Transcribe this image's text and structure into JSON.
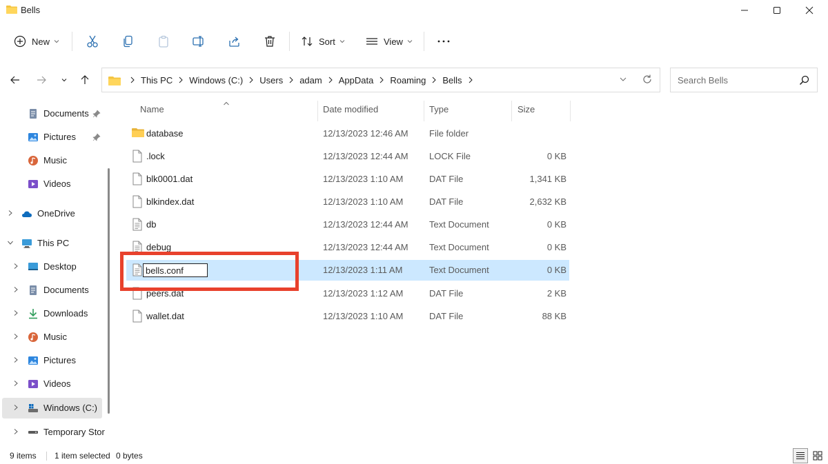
{
  "window": {
    "title": "Bells",
    "accent_folder_color": "#f4c542"
  },
  "toolbar": {
    "new_label": "New",
    "sort_label": "Sort",
    "view_label": "View",
    "more_label": "···"
  },
  "address": {
    "breadcrumbs": [
      "This PC",
      "Windows (C:)",
      "Users",
      "adam",
      "AppData",
      "Roaming",
      "Bells"
    ],
    "search_placeholder": "Search Bells"
  },
  "sidebar": {
    "items": [
      {
        "label": "Documents",
        "icon": "documents-icon",
        "pinned": true
      },
      {
        "label": "Pictures",
        "icon": "pictures-icon",
        "pinned": true
      },
      {
        "label": "Music",
        "icon": "music-icon",
        "pinned": false
      },
      {
        "label": "Videos",
        "icon": "videos-icon",
        "pinned": false
      },
      {
        "label": "OneDrive",
        "icon": "onedrive-icon",
        "pinned": false
      },
      {
        "label": "This PC",
        "icon": "this-pc-icon",
        "pinned": false
      },
      {
        "label": "Desktop",
        "icon": "desktop-icon",
        "pinned": false
      },
      {
        "label": "Documents",
        "icon": "documents-icon",
        "pinned": false
      },
      {
        "label": "Downloads",
        "icon": "downloads-icon",
        "pinned": false
      },
      {
        "label": "Music",
        "icon": "music-icon",
        "pinned": false
      },
      {
        "label": "Pictures",
        "icon": "pictures-icon",
        "pinned": false
      },
      {
        "label": "Videos",
        "icon": "videos-icon",
        "pinned": false
      },
      {
        "label": "Windows (C:)",
        "icon": "drive-icon",
        "pinned": false,
        "selected": true
      },
      {
        "label": "Temporary Stor",
        "icon": "removable-drive-icon",
        "pinned": false
      }
    ]
  },
  "filelist": {
    "columns": {
      "name": "Name",
      "date": "Date modified",
      "type": "Type",
      "size": "Size"
    },
    "rows": [
      {
        "name": "database",
        "date": "12/13/2023 12:46 AM",
        "type": "File folder",
        "size": "",
        "icon": "folder-icon"
      },
      {
        "name": ".lock",
        "date": "12/13/2023 12:44 AM",
        "type": "LOCK File",
        "size": "0 KB",
        "icon": "file-icon"
      },
      {
        "name": "blk0001.dat",
        "date": "12/13/2023 1:10 AM",
        "type": "DAT File",
        "size": "1,341 KB",
        "icon": "file-icon"
      },
      {
        "name": "blkindex.dat",
        "date": "12/13/2023 1:10 AM",
        "type": "DAT File",
        "size": "2,632 KB",
        "icon": "file-icon"
      },
      {
        "name": "db",
        "date": "12/13/2023 12:44 AM",
        "type": "Text Document",
        "size": "0 KB",
        "icon": "text-file-icon"
      },
      {
        "name": "debug",
        "date": "12/13/2023 12:44 AM",
        "type": "Text Document",
        "size": "0 KB",
        "icon": "text-file-icon"
      },
      {
        "name": "bells.conf",
        "date": "12/13/2023 1:11 AM",
        "type": "Text Document",
        "size": "0 KB",
        "icon": "text-file-icon",
        "selected": true,
        "renaming": true
      },
      {
        "name": "peers.dat",
        "date": "12/13/2023 1:12 AM",
        "type": "DAT File",
        "size": "2 KB",
        "icon": "file-icon"
      },
      {
        "name": "wallet.dat",
        "date": "12/13/2023 1:10 AM",
        "type": "DAT File",
        "size": "88 KB",
        "icon": "file-icon"
      }
    ]
  },
  "status": {
    "item_count": "9 items",
    "selection": "1 item selected",
    "selection_size": "0 bytes"
  },
  "colors": {
    "selection_bg": "#cce8ff",
    "highlight_box": "#e8412c"
  }
}
